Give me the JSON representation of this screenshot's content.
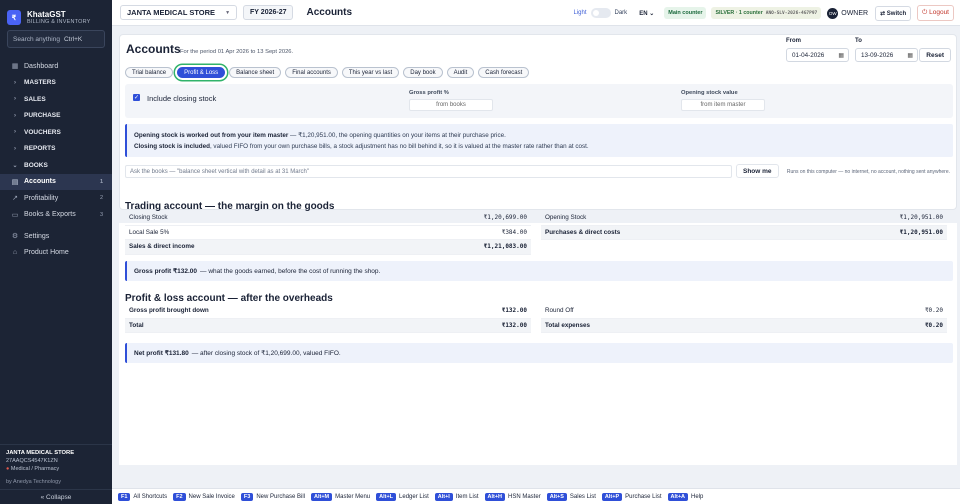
{
  "app": {
    "name": "KhataGST",
    "subtitle": "BILLING & INVENTORY"
  },
  "search": {
    "placeholder": "Search anything",
    "shortcut": "Ctrl+K"
  },
  "nav": [
    {
      "label": "Dashboard",
      "icon": "grid-icon",
      "type": "item"
    },
    {
      "label": "MASTERS",
      "icon": "chevron-right-icon",
      "type": "group"
    },
    {
      "label": "SALES",
      "icon": "chevron-right-icon",
      "type": "group"
    },
    {
      "label": "PURCHASE",
      "icon": "chevron-right-icon",
      "type": "group"
    },
    {
      "label": "VOUCHERS",
      "icon": "chevron-right-icon",
      "type": "group"
    },
    {
      "label": "REPORTS",
      "icon": "chevron-right-icon",
      "type": "group"
    },
    {
      "label": "BOOKS",
      "icon": "chevron-down-icon",
      "type": "group"
    },
    {
      "label": "Accounts",
      "icon": "book-icon",
      "type": "item",
      "count": "1",
      "active": true
    },
    {
      "label": "Profitability",
      "icon": "trend-icon",
      "type": "item",
      "count": "2"
    },
    {
      "label": "Books & Exports",
      "icon": "file-icon",
      "type": "item",
      "count": "3"
    },
    {
      "label": "Settings",
      "icon": "gear-icon",
      "type": "item"
    },
    {
      "label": "Product Home",
      "icon": "home-icon",
      "type": "item"
    }
  ],
  "shop": {
    "name": "JANTA MEDICAL STORE",
    "gstin": "27AAQCS4547K1ZN",
    "type": "Medical / Pharmacy"
  },
  "by": "by Anedya Technology",
  "collapse": "« Collapse",
  "topbar": {
    "store": "JANTA MEDICAL STORE",
    "fy": "FY 2026-27",
    "title": "Accounts",
    "light": "Light",
    "dark": "Dark",
    "lang": "EN",
    "counter": "Main counter",
    "plan": "SILVER · 1 counter",
    "plan_code": "ANO-SLV-2026-4G7P97",
    "user_initials": "OW",
    "user": "OWNER",
    "switch": "Switch",
    "logout": "Logout"
  },
  "accounts": {
    "title": "Accounts",
    "period": "For the period 01 Apr 2026 to 13 Sept 2026.",
    "from_label": "From",
    "from_value": "01-04-2026",
    "to_label": "To",
    "to_value": "13-09-2026",
    "reset": "Reset",
    "tabs": [
      "Trial balance",
      "Profit & Loss",
      "Balance sheet",
      "Final accounts",
      "This year vs last",
      "Day book",
      "Audit",
      "Cash forecast"
    ],
    "include_closing": "Include closing stock",
    "gross_profit_label": "Gross profit %",
    "gross_profit_placeholder": "from books",
    "opening_stock_label": "Opening stock value",
    "opening_stock_placeholder": "from item master",
    "note_line1_bold": "Opening stock is worked out from your item master",
    "note_line1_rest": " — ₹1,20,951.00, the opening quantities on your items at their purchase price.",
    "note_line2_bold": "Closing stock is included",
    "note_line2_rest": ", valued FIFO from your own purchase bills, a stock adjustment has no bill behind it, so it is valued at the master rate rather than at cost.",
    "ask_placeholder": "Ask the books — \"balance sheet vertical with detail as at 31 March\"",
    "show_me": "Show me",
    "privacy": "Runs on this computer — no internet, no account, nothing sent anywhere."
  },
  "trading": {
    "title": "Trading account — the margin on the goods",
    "left": [
      {
        "label": "Closing Stock",
        "value": "₹1,20,699.00"
      },
      {
        "label": "Local Sale 5%",
        "value": "₹384.00"
      },
      {
        "label": "Sales & direct income",
        "value": "₹1,21,083.00",
        "bold": true
      }
    ],
    "right": [
      {
        "label": "Opening Stock",
        "value": "₹1,20,951.00"
      },
      {
        "label": "Purchases & direct costs",
        "value": "₹1,20,951.00",
        "bold": true
      }
    ],
    "summary_bold": "Gross profit ₹132.00",
    "summary_rest": "— what the goods earned, before the cost of running the shop."
  },
  "pnl": {
    "title": "Profit & loss account — after the overheads",
    "left": [
      {
        "label": "Gross profit brought down",
        "value": "₹132.00",
        "bold": true
      },
      {
        "label": "Total",
        "value": "₹132.00",
        "bold": true
      }
    ],
    "right": [
      {
        "label": "Round Off",
        "value": "₹0.20"
      },
      {
        "label": "Total expenses",
        "value": "₹0.20",
        "bold": true
      }
    ],
    "summary_bold": "Net profit ₹131.80",
    "summary_rest": "— after closing stock of ₹1,20,699.00, valued FIFO."
  },
  "shortcuts": [
    {
      "key": "F1",
      "label": "All Shortcuts"
    },
    {
      "key": "F2",
      "label": "New Sale Invoice"
    },
    {
      "key": "F3",
      "label": "New Purchase Bill"
    },
    {
      "key": "Alt+M",
      "label": "Master Menu"
    },
    {
      "key": "Alt+L",
      "label": "Ledger List"
    },
    {
      "key": "Alt+I",
      "label": "Item List"
    },
    {
      "key": "Alt+H",
      "label": "HSN Master"
    },
    {
      "key": "Alt+S",
      "label": "Sales List"
    },
    {
      "key": "Alt+P",
      "label": "Purchase List"
    },
    {
      "key": "Alt+A",
      "label": "Help"
    }
  ]
}
